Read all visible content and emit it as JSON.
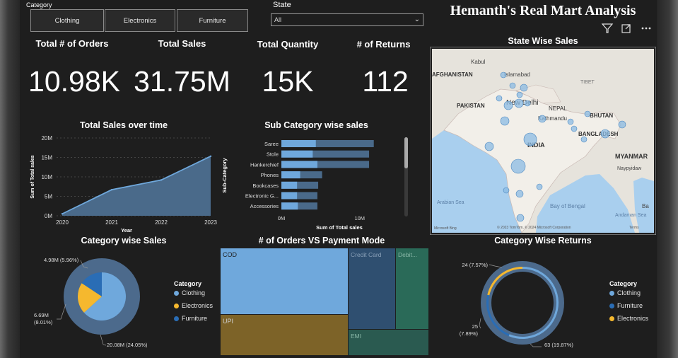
{
  "header": {
    "category_slicer": {
      "title": "Category",
      "options": [
        "Clothing",
        "Electronics",
        "Furniture"
      ]
    },
    "state_slicer": {
      "title": "State",
      "selected": "All"
    },
    "report_title": "Hemanth's Real Mart Analysis"
  },
  "kpis": [
    {
      "label": "Total # of Orders",
      "value": "10.98K"
    },
    {
      "label": "Total Sales",
      "value": "31.75M"
    },
    {
      "label": "Total Quantity",
      "value": "15K"
    },
    {
      "label": "# of Returns",
      "value": "112"
    }
  ],
  "map": {
    "title": "State Wise Sales",
    "labels": [
      "AFGHANISTAN",
      "Kabul",
      "Islamabad",
      "TIBET",
      "PAKISTAN",
      "New Delhi",
      "NEPAL",
      "BHUTAN",
      "Kathmandu",
      "BANGLADESH",
      "INDIA",
      "MYANMAR",
      "Naypyidaw",
      "Arabian Sea",
      "Bay of Bengal",
      "Andaman Sea",
      "Ba"
    ],
    "attribution": "© 2023 TomTom, © 2024 Microsoft Corporation",
    "terms": "Terms",
    "logo": "Microsoft Bing"
  },
  "sales_over_time": {
    "title": "Total Sales over time",
    "chart_data": {
      "type": "area",
      "x": [
        "2020",
        "2021",
        "2022",
        "2023"
      ],
      "values": [
        0.5,
        6.7,
        9.2,
        15.3
      ],
      "xlabel": "Year",
      "ylabel": "Sum of Total sales",
      "yticks": [
        "0M",
        "5M",
        "10M",
        "15M",
        "20M"
      ],
      "ylim": [
        0,
        20
      ],
      "color": "#6fa8dc"
    }
  },
  "subcategory_sales": {
    "title": "Sub Category wise sales",
    "chart_data": {
      "type": "bar",
      "orientation": "horizontal",
      "categories": [
        "Saree",
        "Stole",
        "Hankerchief",
        "Phones",
        "Bookcases",
        "Electronic G...",
        "Accessories"
      ],
      "values": [
        11.8,
        11.2,
        11.2,
        5.2,
        4.7,
        4.6,
        4.6
      ],
      "highlight": [
        4.4,
        4.0,
        4.6,
        2.4,
        2.0,
        2.0,
        2.1
      ],
      "xlabel": "Sum of Total sales",
      "ylabel": "Sub-Category",
      "xticks": [
        "0M",
        "10M"
      ],
      "xlim": [
        0,
        13
      ],
      "color": "#4a6a8a",
      "highlight_color": "#6fa8dc"
    }
  },
  "category_sales": {
    "title": "Category wise Sales",
    "chart_data": {
      "type": "pie",
      "labels": [
        "Clothing",
        "Electronics",
        "Furniture"
      ],
      "values": [
        20.08,
        6.69,
        4.98
      ],
      "data_labels": [
        "20.08M (24.05%)",
        "6.69M (8.01%)",
        "4.98M (5.96%)"
      ],
      "colors": [
        "#6fa8dc",
        "#f5b82e",
        "#2a6db5"
      ]
    },
    "legend_title": "Category",
    "legend": [
      "Clothing",
      "Electronics",
      "Furniture"
    ]
  },
  "payment_mode": {
    "title": "# of Orders VS Payment Mode",
    "chart_data": {
      "type": "treemap",
      "labels": [
        "COD",
        "UPI",
        "Credit Card",
        "Debit...",
        "EMI"
      ],
      "colors": [
        "#6fa8dc",
        "#7d6328",
        "#2f4f70",
        "#2a6a58",
        "#2a5a50"
      ]
    }
  },
  "category_returns": {
    "title": "Category Wise Returns",
    "chart_data": {
      "type": "pie",
      "labels": [
        "Clothing",
        "Furniture",
        "Electronics"
      ],
      "values": [
        63,
        25,
        24
      ],
      "data_labels": [
        "63 (19.87%)",
        "25 (7.89%)",
        "24 (7.57%)"
      ],
      "colors": [
        "#6fa8dc",
        "#2a6db5",
        "#f5b82e"
      ]
    },
    "legend_title": "Category",
    "legend": [
      "Clothing",
      "Furniture",
      "Electronics"
    ]
  },
  "toolbar": {
    "filter": "filter-icon",
    "focus": "expand-icon",
    "more": "more-options-icon"
  }
}
